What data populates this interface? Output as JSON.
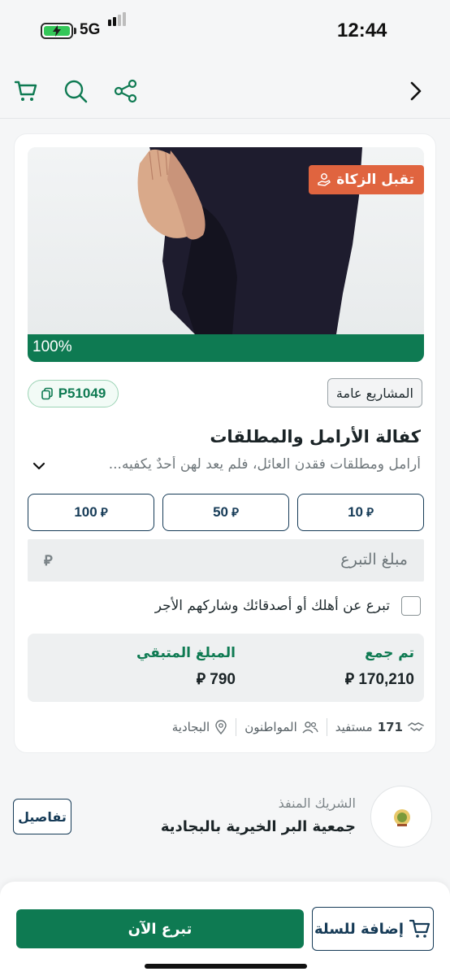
{
  "status_bar": {
    "time": "12:44",
    "network": "5G"
  },
  "project": {
    "zakat_badge": "تقبل الزكاة",
    "progress_label": "100%",
    "progress_fraction": 1.0,
    "code": "P51049",
    "category": "المشاريع عامة",
    "title": "كفالة الأرامل والمطلقات",
    "description": "أرامل ومطلقات فقدن العائل، فلم يعد لهن أحدٌ يكفيه..."
  },
  "amounts": [
    {
      "value": "10",
      "currency": "⃁"
    },
    {
      "value": "50",
      "currency": "⃁"
    },
    {
      "value": "100",
      "currency": "⃁"
    }
  ],
  "amount_input": {
    "placeholder": "مبلغ التبرع",
    "currency": "⃁"
  },
  "gift": {
    "label": "تبرع عن أهلك أو أصدقائك وشاركهم الأجر"
  },
  "stats": {
    "collected_label": "تم جمع",
    "collected_value": "170,210",
    "remaining_label": "المبلغ المتبقي",
    "remaining_value": "790",
    "currency": "⃁"
  },
  "meta": {
    "beneficiaries_count": "171",
    "beneficiaries_label": "مستفيد",
    "target": "المواطنون",
    "location": "البجادية"
  },
  "partner": {
    "label": "الشريك المنفذ",
    "name": "جمعية البر الخيرية بالبجادية",
    "details_button": "تفاصيل"
  },
  "actions": {
    "donate_now": "تبرع الآن",
    "add_to_cart": "إضافة للسلة"
  },
  "colors": {
    "primary": "#0e7a52",
    "navy": "#163b57",
    "zakat": "#e0643f"
  }
}
